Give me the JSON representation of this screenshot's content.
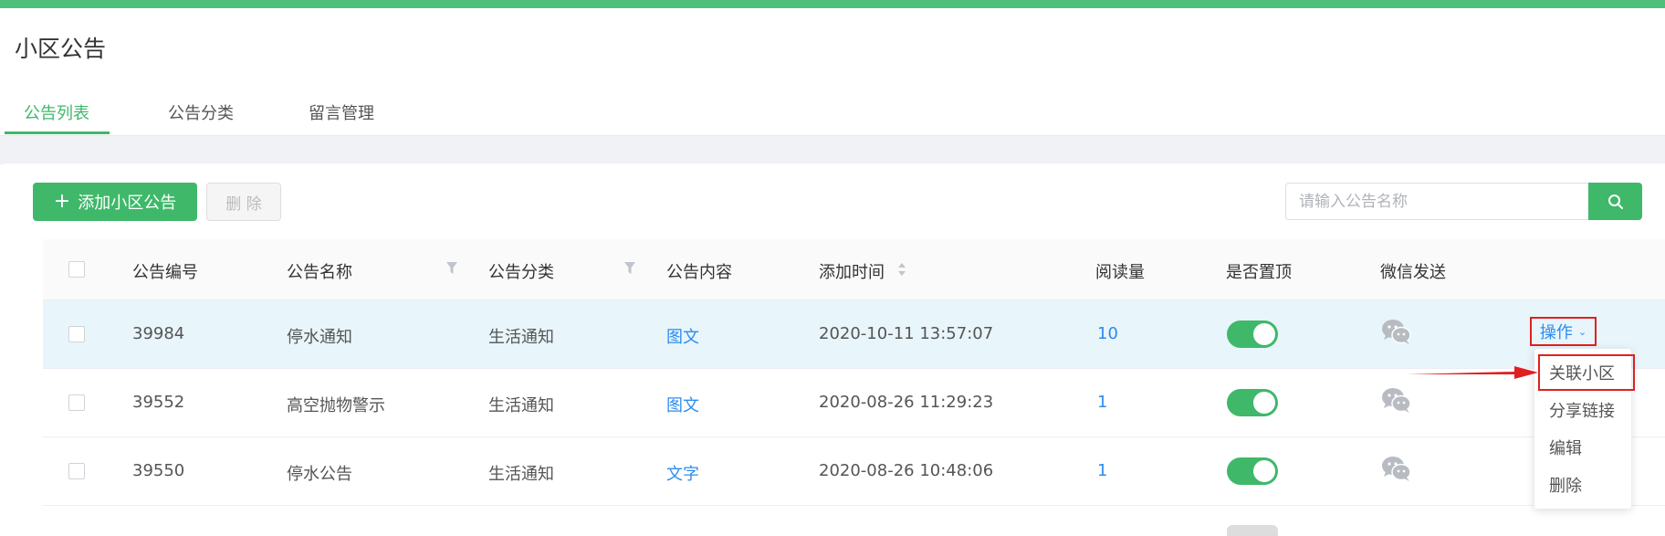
{
  "header": {
    "title": "小区公告"
  },
  "tabs": [
    {
      "label": "公告列表",
      "active": true
    },
    {
      "label": "公告分类",
      "active": false
    },
    {
      "label": "留言管理",
      "active": false
    }
  ],
  "toolbar": {
    "add_label": "添加小区公告",
    "delete_label": "删 除"
  },
  "search": {
    "placeholder": "请输入公告名称",
    "value": ""
  },
  "table": {
    "columns": [
      "公告编号",
      "公告名称",
      "公告分类",
      "公告内容",
      "添加时间",
      "阅读量",
      "是否置顶",
      "微信发送"
    ],
    "rows": [
      {
        "id": "39984",
        "name": "停水通知",
        "category": "生活通知",
        "content": "图文",
        "time": "2020-10-11 13:57:07",
        "views": "10",
        "pinned": true,
        "highlighted": true
      },
      {
        "id": "39552",
        "name": "高空抛物警示",
        "category": "生活通知",
        "content": "图文",
        "time": "2020-08-26 11:29:23",
        "views": "1",
        "pinned": true,
        "highlighted": false
      },
      {
        "id": "39550",
        "name": "停水公告",
        "category": "生活通知",
        "content": "文字",
        "time": "2020-08-26 10:48:06",
        "views": "1",
        "pinned": true,
        "highlighted": false
      }
    ]
  },
  "actions": {
    "label": "操作",
    "menu": [
      "关联小区",
      "分享链接",
      "编辑",
      "删除"
    ],
    "highlighted_item": "关联小区"
  },
  "colors": {
    "accent": "#3fb86a",
    "link": "#2d8cf0",
    "highlight_border": "#e02020",
    "row_highlight": "#e8f5fb"
  },
  "icons": [
    "plus-icon",
    "search-icon",
    "filter-icon",
    "sort-icon",
    "wechat-icon",
    "chevron-down-icon",
    "red-arrow-annotation"
  ]
}
